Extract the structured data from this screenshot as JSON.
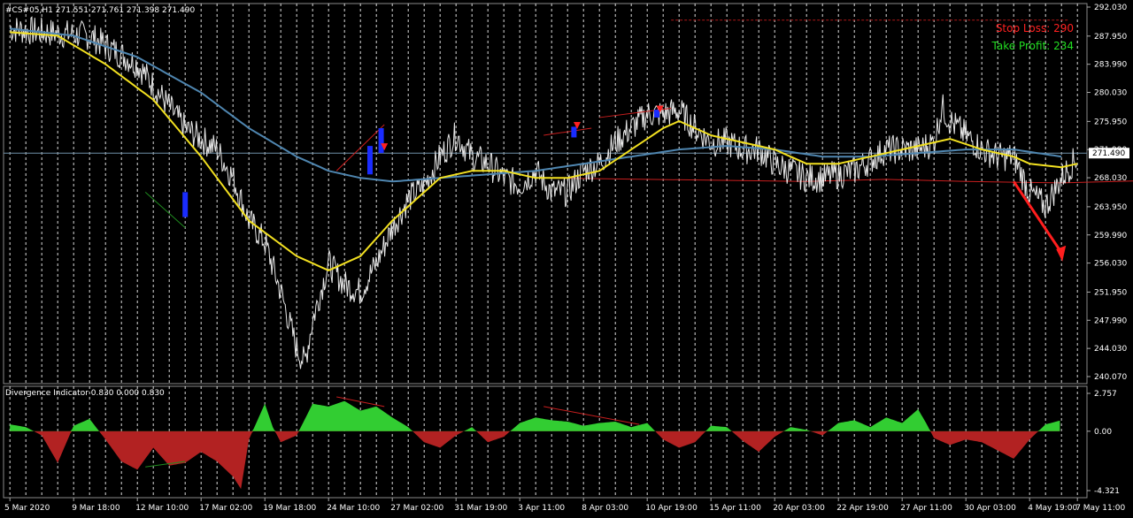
{
  "chart_data": [
    {
      "type": "line",
      "title": "#CS#05,H1  271.551 271.761 271.398 271.490",
      "series": [],
      "y_ticks": [
        "292.030",
        "287.950",
        "283.990",
        "280.030",
        "275.950",
        "271.990",
        "268.030",
        "263.950",
        "259.990",
        "256.030",
        "251.950",
        "247.990",
        "244.030",
        "240.070"
      ],
      "ylim": [
        240.07,
        292.03
      ],
      "current_price": "271.490",
      "x_ticks": [
        "5 Mar 2020",
        "9 Mar 18:00",
        "12 Mar 10:00",
        "17 Mar 02:00",
        "19 Mar 18:00",
        "24 Mar 10:00",
        "27 Mar 02:00",
        "31 Mar 19:00",
        "3 Apr 11:00",
        "8 Apr 03:00",
        "10 Apr 19:00",
        "15 Apr 11:00",
        "20 Apr 03:00",
        "22 Apr 19:00",
        "27 Apr 11:00",
        "30 Apr 03:00",
        "4 May 19:00",
        "7 May 11:00"
      ],
      "price_anchors": [
        [
          0,
          289
        ],
        [
          2,
          288.5
        ],
        [
          5,
          288
        ],
        [
          8,
          284
        ],
        [
          11,
          275
        ],
        [
          13,
          272
        ],
        [
          14,
          268
        ],
        [
          15,
          262
        ],
        [
          16,
          259
        ],
        [
          17,
          252
        ],
        [
          18,
          244
        ],
        [
          18.5,
          242
        ],
        [
          19,
          248
        ],
        [
          20,
          256
        ],
        [
          21,
          253
        ],
        [
          22,
          252
        ],
        [
          23,
          256
        ],
        [
          24,
          261
        ],
        [
          25,
          265
        ],
        [
          26,
          267
        ],
        [
          27,
          271
        ],
        [
          28,
          274
        ],
        [
          29,
          271
        ],
        [
          30,
          270
        ],
        [
          31,
          268
        ],
        [
          32,
          267
        ],
        [
          33,
          269
        ],
        [
          34,
          266
        ],
        [
          35,
          266
        ],
        [
          36,
          269
        ],
        [
          37,
          270
        ],
        [
          38,
          273
        ],
        [
          39,
          275
        ],
        [
          40,
          277
        ],
        [
          41,
          277
        ],
        [
          42,
          277.5
        ],
        [
          43,
          275
        ],
        [
          44,
          273
        ],
        [
          45,
          273
        ],
        [
          46,
          272
        ],
        [
          47,
          272
        ],
        [
          48,
          270
        ],
        [
          49,
          269
        ],
        [
          50,
          268
        ],
        [
          51,
          268
        ],
        [
          52,
          268.5
        ],
        [
          53,
          269
        ],
        [
          54,
          270.5
        ],
        [
          55,
          272
        ],
        [
          56,
          272
        ],
        [
          57,
          272
        ],
        [
          58,
          273
        ],
        [
          58.5,
          278
        ],
        [
          59,
          276
        ],
        [
          60,
          274
        ],
        [
          61,
          272
        ],
        [
          62,
          271
        ],
        [
          63,
          271
        ],
        [
          64,
          266
        ],
        [
          65,
          264
        ],
        [
          66,
          268
        ],
        [
          67,
          271
        ]
      ],
      "ma_fast_anchors": [
        [
          0,
          288.5
        ],
        [
          3,
          288
        ],
        [
          6,
          284
        ],
        [
          9,
          279
        ],
        [
          12,
          271
        ],
        [
          15,
          262
        ],
        [
          18,
          257
        ],
        [
          20,
          255
        ],
        [
          22,
          257
        ],
        [
          24,
          262
        ],
        [
          26,
          266
        ],
        [
          27,
          268
        ],
        [
          29,
          269
        ],
        [
          31,
          269
        ],
        [
          33,
          268
        ],
        [
          35,
          268
        ],
        [
          37,
          269
        ],
        [
          39,
          272
        ],
        [
          41,
          275
        ],
        [
          42,
          276
        ],
        [
          44,
          274
        ],
        [
          46,
          273
        ],
        [
          48,
          272
        ],
        [
          50,
          270
        ],
        [
          52,
          270
        ],
        [
          54,
          271
        ],
        [
          56,
          272
        ],
        [
          58,
          273
        ],
        [
          59,
          273.5
        ],
        [
          61,
          272
        ],
        [
          63,
          271
        ],
        [
          64,
          270
        ],
        [
          66,
          269.5
        ],
        [
          67,
          270
        ]
      ],
      "ma_slow_anchors": [
        [
          0,
          289
        ],
        [
          4,
          288
        ],
        [
          8,
          285
        ],
        [
          12,
          280
        ],
        [
          15,
          275
        ],
        [
          18,
          271
        ],
        [
          20,
          269
        ],
        [
          22,
          268
        ],
        [
          24,
          267.5
        ],
        [
          27,
          268
        ],
        [
          30,
          268.5
        ],
        [
          33,
          269
        ],
        [
          36,
          270
        ],
        [
          39,
          271
        ],
        [
          42,
          272
        ],
        [
          45,
          272.5
        ],
        [
          48,
          272
        ],
        [
          51,
          271
        ],
        [
          54,
          271
        ],
        [
          57,
          271.5
        ],
        [
          60,
          272
        ],
        [
          63,
          272
        ],
        [
          66,
          271
        ]
      ],
      "support_line_anchors": [
        [
          33,
          268
        ],
        [
          40,
          267.8
        ],
        [
          50,
          267.5
        ],
        [
          55,
          267.8
        ],
        [
          60,
          267.5
        ],
        [
          66,
          267.3
        ],
        [
          71,
          267.6
        ]
      ],
      "stop_loss_level": 290.2,
      "divergence_lines": [
        {
          "from": [
            8.5,
            266
          ],
          "to": [
            11,
            261
          ],
          "color": "#1f8c1f"
        },
        {
          "from": [
            20.5,
            269
          ],
          "to": [
            23.5,
            275.5
          ],
          "color": "#c81e1e"
        },
        {
          "from": [
            33.5,
            274
          ],
          "to": [
            36.5,
            275
          ],
          "color": "#c81e1e"
        },
        {
          "from": [
            37,
            276.5
          ],
          "to": [
            41.5,
            277.8
          ],
          "color": "#c81e1e"
        }
      ],
      "signal_arrows": [
        {
          "x": 23.5,
          "y": 272.5,
          "dir": "down",
          "color": "#ff2020"
        },
        {
          "x": 35.6,
          "y": 275.5,
          "dir": "down",
          "color": "#ff2020"
        },
        {
          "x": 40.8,
          "y": 277.8,
          "dir": "down",
          "color": "#ff2020"
        }
      ],
      "buy_markers": [
        {
          "x": 11,
          "y_from": 266,
          "y_to": 262.5
        },
        {
          "x": 22.6,
          "y_from": 272.5,
          "y_to": 268.5
        },
        {
          "x": 23.3,
          "y_from": 275,
          "y_to": 271.5
        },
        {
          "x": 35.4,
          "y_from": 275.2,
          "y_to": 273.7
        },
        {
          "x": 40.6,
          "y_from": 277.6,
          "y_to": 276.5
        }
      ],
      "big_arrow": {
        "from": [
          63,
          267.5
        ],
        "to": [
          66,
          256.5
        ]
      }
    },
    {
      "type": "area",
      "title": "Divergence Indicator 0.830 0.000 0.830",
      "y_ticks": [
        "2.757",
        "0.00",
        "-4.321"
      ],
      "ylim": [
        -4.321,
        2.757
      ],
      "positive_color": "#32cd32",
      "negative_color": "#b22222",
      "value_anchors": [
        [
          0,
          0.5
        ],
        [
          1,
          0.3
        ],
        [
          2,
          -0.3
        ],
        [
          3,
          -2.3
        ],
        [
          4,
          0.4
        ],
        [
          5,
          0.9
        ],
        [
          6,
          -0.6
        ],
        [
          7,
          -2.2
        ],
        [
          8,
          -2.8
        ],
        [
          9,
          -1.2
        ],
        [
          10,
          -2.5
        ],
        [
          11,
          -2.3
        ],
        [
          12,
          -1.5
        ],
        [
          13,
          -2.2
        ],
        [
          14,
          -3.3
        ],
        [
          14.5,
          -4.2
        ],
        [
          15,
          -0.6
        ],
        [
          16,
          2.0
        ],
        [
          16.5,
          0.3
        ],
        [
          17,
          -0.8
        ],
        [
          18,
          -0.3
        ],
        [
          19,
          2.0
        ],
        [
          20,
          1.8
        ],
        [
          21,
          2.2
        ],
        [
          22,
          1.5
        ],
        [
          23,
          1.8
        ],
        [
          24,
          1.0
        ],
        [
          25,
          0.3
        ],
        [
          26,
          -0.8
        ],
        [
          27,
          -1.2
        ],
        [
          28,
          -0.3
        ],
        [
          29,
          0.3
        ],
        [
          30,
          -0.8
        ],
        [
          31,
          -0.4
        ],
        [
          32,
          0.6
        ],
        [
          33,
          1.0
        ],
        [
          34,
          0.8
        ],
        [
          35,
          0.7
        ],
        [
          36,
          0.4
        ],
        [
          37,
          0.6
        ],
        [
          38,
          0.7
        ],
        [
          39,
          0.3
        ],
        [
          40,
          0.6
        ],
        [
          41,
          -0.6
        ],
        [
          42,
          -1.2
        ],
        [
          43,
          -0.8
        ],
        [
          44,
          0.4
        ],
        [
          45,
          0.3
        ],
        [
          46,
          -0.7
        ],
        [
          47,
          -1.5
        ],
        [
          48,
          -0.4
        ],
        [
          49,
          0.3
        ],
        [
          50,
          0.1
        ],
        [
          51,
          -0.3
        ],
        [
          52,
          0.6
        ],
        [
          53,
          0.8
        ],
        [
          54,
          0.3
        ],
        [
          55,
          1.0
        ],
        [
          56,
          0.6
        ],
        [
          57,
          1.6
        ],
        [
          57.5,
          0.6
        ],
        [
          58,
          -0.5
        ],
        [
          59,
          -1.0
        ],
        [
          60,
          -0.6
        ],
        [
          61,
          -0.8
        ],
        [
          62,
          -1.4
        ],
        [
          63,
          -2.0
        ],
        [
          64,
          -0.6
        ],
        [
          65,
          0.5
        ],
        [
          66,
          0.8
        ]
      ],
      "divergence_lines": [
        {
          "from": [
            8.5,
            -2.6
          ],
          "to": [
            11,
            -2.2
          ],
          "color": "#1f8c1f"
        },
        {
          "from": [
            20.5,
            2.5
          ],
          "to": [
            23.5,
            1.8
          ],
          "color": "#c81e1e"
        },
        {
          "from": [
            33.5,
            1.8
          ],
          "to": [
            39.5,
            0.5
          ],
          "color": "#c81e1e"
        }
      ]
    }
  ],
  "labels": {
    "stop_loss": "Stop Loss: 290",
    "take_profit": "Take Profit: 234"
  }
}
